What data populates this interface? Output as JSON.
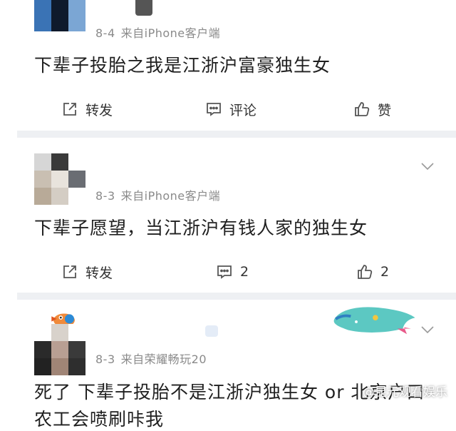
{
  "comments": [
    {
      "date": "8-4",
      "source": "来自iPhone客户端",
      "text": "下辈子投胎之我是江浙沪富豪独生女",
      "repost_label": "转发",
      "comment_label": "评论",
      "like_label": "赞"
    },
    {
      "date": "8-3",
      "source": "来自iPhone客户端",
      "text": "下辈子愿望，当江浙沪有钱人家的独生女",
      "repost_label": "转发",
      "comment_count": "2",
      "like_count": "2"
    },
    {
      "date": "8-3",
      "source": "来自荣耀畅玩20",
      "text": "死了 下辈子投胎不是江浙沪独生女 or 北京户口",
      "text_line2": "农工会喷刷咔我"
    }
  ],
  "watermark": "@昆元观看娱乐",
  "colors": {
    "separator": "#eef0f3",
    "meta_text": "#8a8a8a",
    "icon": "#555555"
  }
}
